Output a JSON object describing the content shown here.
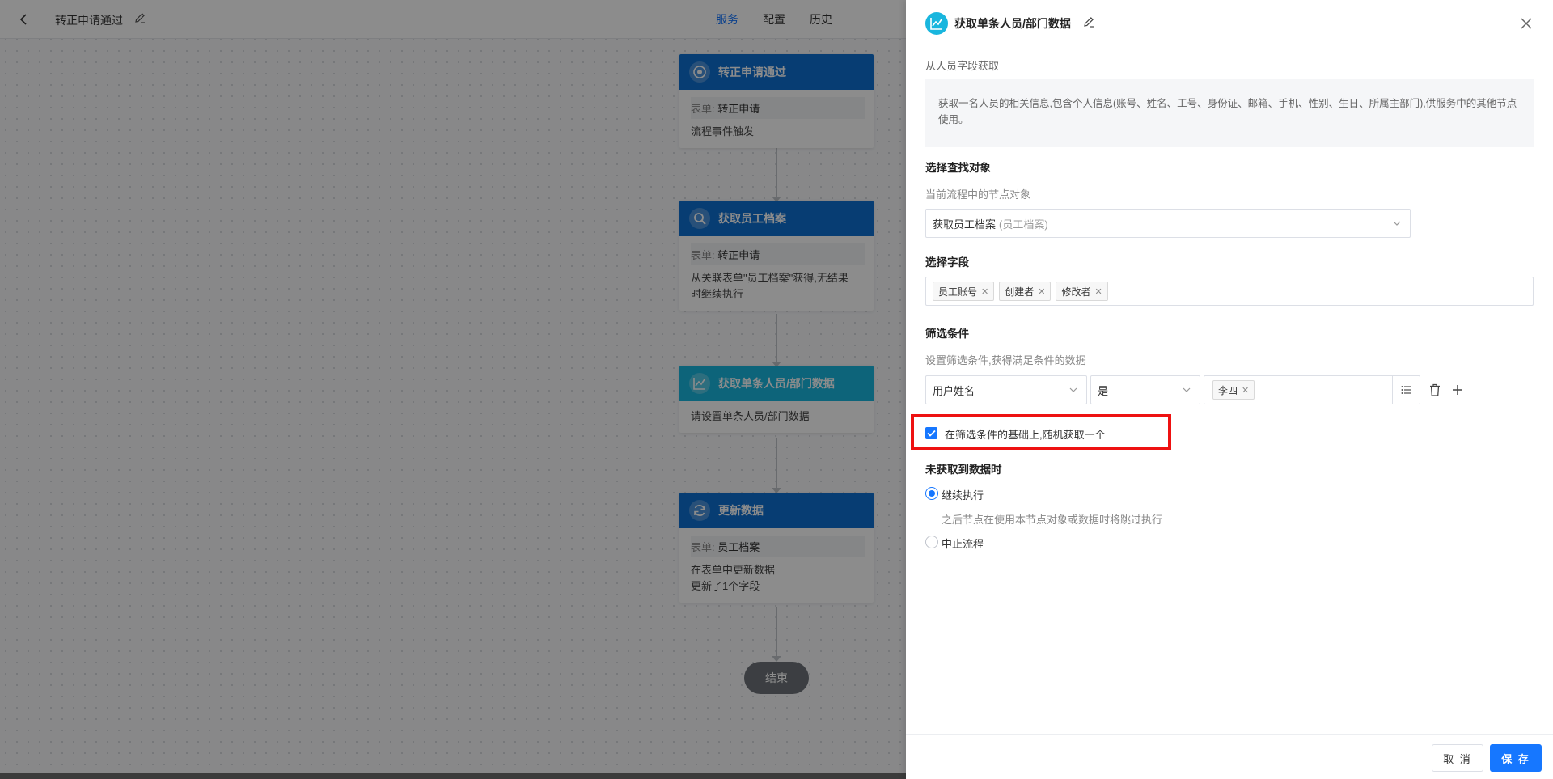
{
  "header": {
    "flow_title": "转正申请通过",
    "tabs": [
      {
        "label": "服务",
        "active": true
      },
      {
        "label": "配置",
        "active": false
      },
      {
        "label": "历史",
        "active": false
      }
    ]
  },
  "nodes": [
    {
      "title": "转正申请通过",
      "form_label": "表单:",
      "form_value": "转正申请",
      "lines": [
        "流程事件触发"
      ],
      "icon": "target-icon"
    },
    {
      "title": "获取员工档案",
      "form_label": "表单:",
      "form_value": "转正申请",
      "lines": [
        "从关联表单\"员工档案\"获得,无结果",
        "时继续执行"
      ],
      "icon": "search-icon"
    },
    {
      "title": "获取单条人员/部门数据",
      "lines": [
        "请设置单条人员/部门数据"
      ],
      "icon": "chart-line-icon"
    },
    {
      "title": "更新数据",
      "form_label": "表单:",
      "form_value": "员工档案",
      "lines": [
        "在表单中更新数据",
        "更新了1个字段"
      ],
      "icon": "refresh-icon"
    }
  ],
  "end_node": "结束",
  "drawer": {
    "title": "获取单条人员/部门数据",
    "source_hint": "从人员字段获取",
    "description": "获取一名人员的相关信息,包含个人信息(账号、姓名、工号、身份证、邮箱、手机、性别、生日、所属主部门),供服务中的其他节点使用。",
    "target": {
      "section_title": "选择查找对象",
      "hint": "当前流程中的节点对象",
      "selected": "获取员工档案",
      "selected_sub": "(员工档案)"
    },
    "fields": {
      "section_title": "选择字段",
      "tags": [
        "员工账号",
        "创建者",
        "修改者"
      ]
    },
    "filter": {
      "section_title": "筛选条件",
      "hint": "设置筛选条件,获得满足条件的数据",
      "field": "用户姓名",
      "operator": "是",
      "value_tag": "李四"
    },
    "random_pick": {
      "label": "在筛选条件的基础上,随机获取一个",
      "checked": true
    },
    "no_data": {
      "section_title": "未获取到数据时",
      "options": [
        {
          "label": "继续执行",
          "selected": true
        },
        {
          "label": "中止流程",
          "selected": false
        }
      ],
      "continue_hint": "之后节点在使用本节点对象或数据时将跳过执行"
    },
    "buttons": {
      "cancel": "取 消",
      "save": "保 存"
    }
  },
  "colors": {
    "primary": "#1677ff",
    "node_blue": "#0d6fd1",
    "node_cyan": "#19b6de",
    "highlight": "#ee1111"
  }
}
